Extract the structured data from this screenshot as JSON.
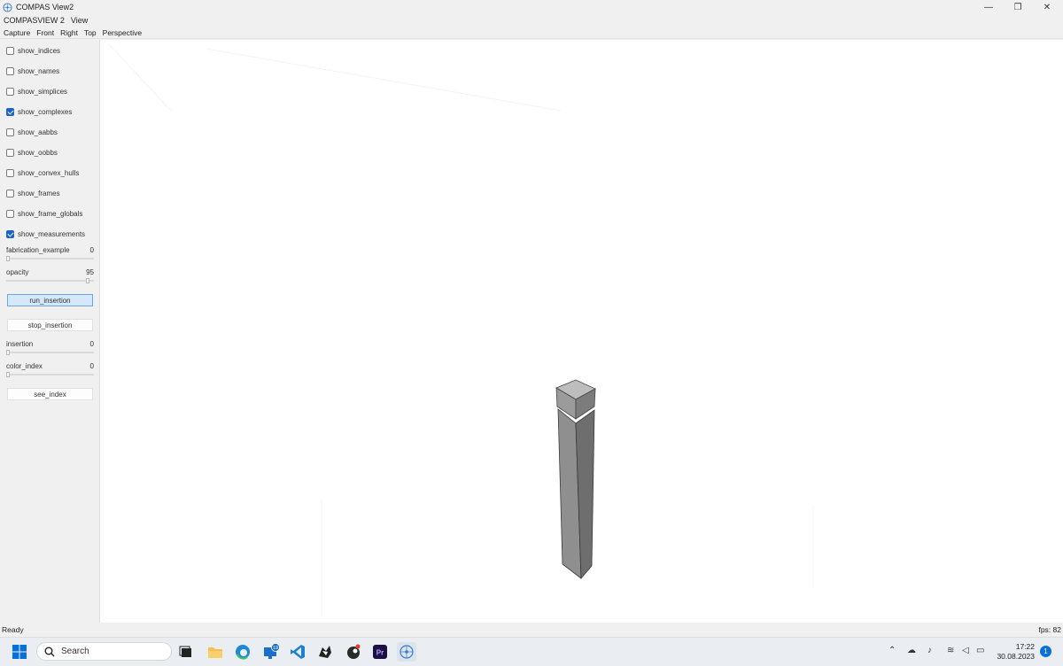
{
  "window": {
    "title": "COMPAS View2",
    "controls": {
      "minimize": "—",
      "restore": "❐",
      "close": "✕"
    }
  },
  "menubar": {
    "items": [
      "COMPASVIEW 2",
      "View"
    ]
  },
  "toolbar": {
    "items": [
      "Capture",
      "Front",
      "Right",
      "Top",
      "Perspective"
    ]
  },
  "sidebar": {
    "checkboxes": [
      {
        "label": "show_indices",
        "checked": false
      },
      {
        "label": "show_names",
        "checked": false
      },
      {
        "label": "show_simplices",
        "checked": false
      },
      {
        "label": "show_complexes",
        "checked": true
      },
      {
        "label": "show_aabbs",
        "checked": false
      },
      {
        "label": "show_oobbs",
        "checked": false
      },
      {
        "label": "show_convex_hulls",
        "checked": false
      },
      {
        "label": "show_frames",
        "checked": false
      },
      {
        "label": "show_frame_globals",
        "checked": false
      },
      {
        "label": "show_measurements",
        "checked": true
      }
    ],
    "sliders": [
      {
        "label": "fabrication_example",
        "value": "0",
        "fraction": 0
      },
      {
        "label": "opacity",
        "value": "95",
        "fraction": 0.95
      },
      {
        "label": "insertion",
        "value": "0",
        "fraction": 0
      },
      {
        "label": "color_index",
        "value": "0",
        "fraction": 0
      }
    ],
    "buttons": {
      "run_insertion": "run_insertion",
      "stop_insertion": "stop_insertion",
      "see_index": "see_index"
    }
  },
  "statusbar": {
    "left": "Ready",
    "right": "fps: 82"
  },
  "taskbar": {
    "search_placeholder": "Search",
    "apps": [
      "windows-start-icon",
      "task-view-icon",
      "file-explorer-icon",
      "edge-browser-icon",
      "remote-desktop-icon",
      "vscode-icon",
      "rhino-icon",
      "grasshopper-icon",
      "premiere-pro-icon",
      "compas-view-icon"
    ],
    "premiere_label": "Pr",
    "remote_badge": "19",
    "clock": {
      "time": "17:22",
      "date": "30.08.2023"
    },
    "notification_count": "1"
  },
  "colors": {
    "accent": "#1a63c6",
    "button_active": "#d5e8fb",
    "viewport_bg": "#ffffff",
    "column_front": "#8f8f8f",
    "column_side": "#6e6e6e"
  }
}
